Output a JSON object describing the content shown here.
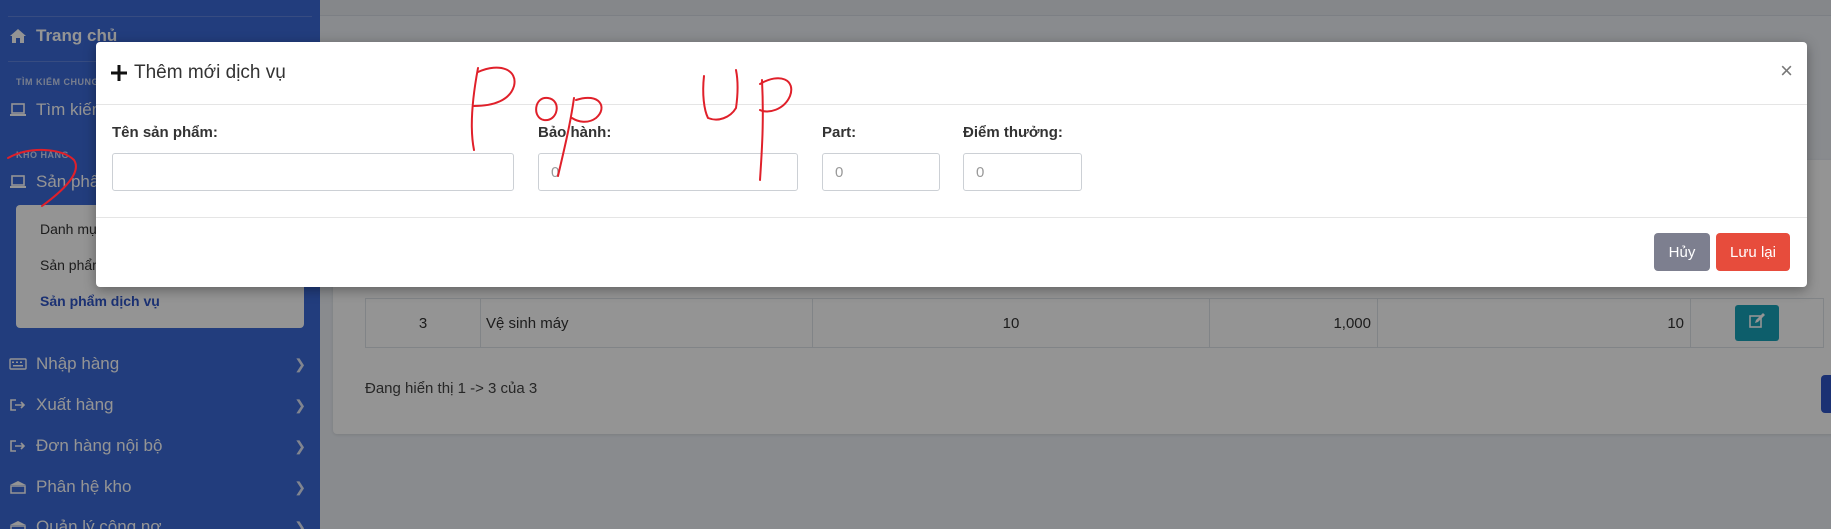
{
  "sidebar": {
    "home": "Trang chủ",
    "search_header": "TÌM KIẾM CHUNG",
    "search": "Tìm kiếm",
    "warehouse_header": "KHO HÀNG",
    "products": "Sản phẩm",
    "submenu": [
      "Danh mục",
      "Sản phẩm",
      "Sản phẩm dịch vụ"
    ],
    "items": [
      "Nhập hàng",
      "Xuất hàng",
      "Đơn hàng nội bộ",
      "Phân hệ kho",
      "Quản lý công nợ"
    ]
  },
  "table": {
    "row": {
      "no": "3",
      "name": "Vệ sinh máy",
      "warranty": "10",
      "price": "1,000",
      "points": "10"
    }
  },
  "pager": {
    "text": "Đang hiển thị 1 -> 3 của 3"
  },
  "modal": {
    "title": "Thêm mới dịch vụ",
    "close": "×",
    "fields": {
      "name_label": "Tên sản phẩm:",
      "name_value": "",
      "warranty_label": "Bảo hành:",
      "warranty_placeholder": "0",
      "part_label": "Part:",
      "part_placeholder": "0",
      "points_label": "Điểm thưởng:",
      "points_placeholder": "0"
    },
    "cancel_label": "Hủy",
    "save_label": "Lưu lại"
  },
  "colors": {
    "sidebar": "#3c6ad8",
    "save": "#e74c3c",
    "cancel": "#7d7f8f",
    "edit": "#17a2b8",
    "annotation": "#e0202a"
  },
  "icons": [
    "home-icon",
    "laptop-icon",
    "keyboard-icon",
    "sign-out-icon",
    "building-icon",
    "plus-icon",
    "close-icon",
    "edit-icon",
    "chevron-right-icon"
  ]
}
